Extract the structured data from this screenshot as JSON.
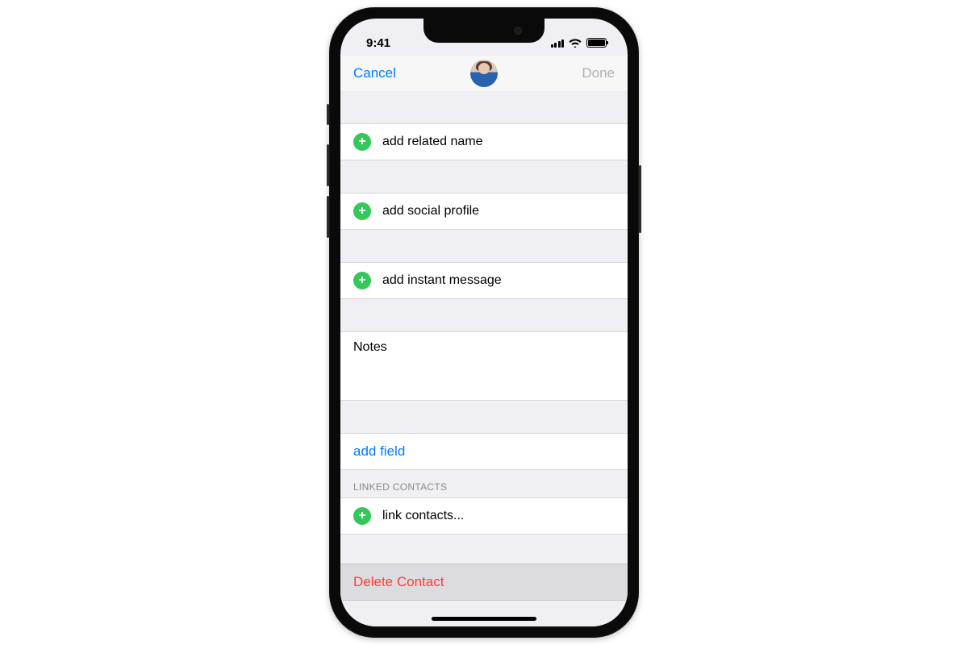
{
  "status": {
    "time": "9:41"
  },
  "nav": {
    "cancel": "Cancel",
    "done": "Done"
  },
  "rows": {
    "add_related_name": "add related name",
    "add_social_profile": "add social profile",
    "add_instant_message": "add instant message",
    "notes_label": "Notes",
    "add_field": "add field",
    "link_contacts": "link contacts..."
  },
  "sections": {
    "linked_contacts": "LINKED CONTACTS"
  },
  "actions": {
    "delete_contact": "Delete Contact"
  }
}
